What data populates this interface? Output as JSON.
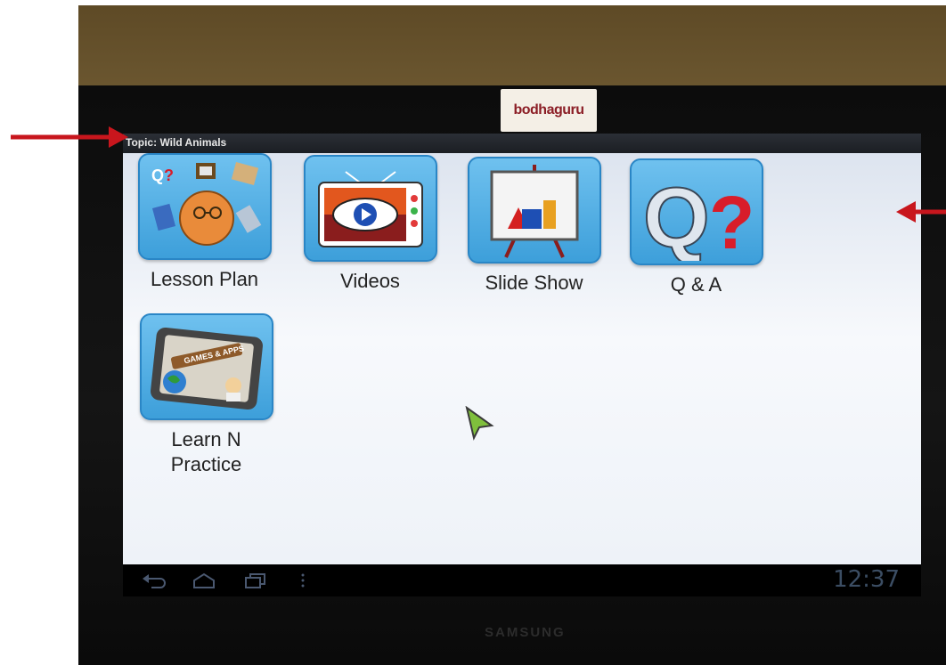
{
  "screen": {
    "topic": "Topic: Wild Animals",
    "tiles": [
      {
        "label": "Lesson Plan",
        "icon": "lesson-plan-icon"
      },
      {
        "label": "Videos",
        "icon": "videos-icon"
      },
      {
        "label": "Slide Show",
        "icon": "slide-show-icon"
      },
      {
        "label": "Q & A",
        "icon": "q-and-a-icon"
      },
      {
        "label": "Learn N\nPractice",
        "icon": "learn-n-practice-icon",
        "banner": "GAMES & APPS"
      }
    ],
    "clock": "12:37"
  },
  "sticker": {
    "text": "bodhaguru"
  },
  "monitor": {
    "brand": "SAMSUNG"
  },
  "colors": {
    "tile_blue": "#3d9fda",
    "arrow_red": "#c8161d",
    "clock_text": "#3b4d63"
  }
}
